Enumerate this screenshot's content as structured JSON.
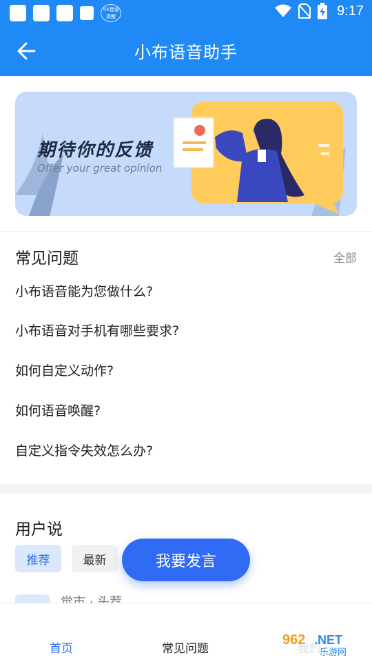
{
  "status": {
    "time": "9:17",
    "badge_top": "55音谱",
    "badge_bottom": "提醒"
  },
  "app_bar": {
    "title": "小布语音助手"
  },
  "banner": {
    "title": "期待你的反馈",
    "subtitle": "Offer your great opinion"
  },
  "faq": {
    "title": "常见问题",
    "all_label": "全部",
    "items": [
      "小布语音能为您做什么?",
      "小布语音对手机有哪些要求?",
      "如何自定义动作?",
      "如何语音唤醒?",
      "自定义指令失效怎么办?"
    ]
  },
  "user_say": {
    "title": "用户说",
    "tabs": [
      "推荐",
      "最新"
    ],
    "speak_button": "我要发言",
    "peek_text": "觉市 · 头荐"
  },
  "bottom_nav": {
    "items": [
      "首页",
      "常见问题",
      "我的"
    ]
  },
  "watermark": {
    "text_top": "962.NET",
    "text_bottom": "乐游网"
  },
  "colors": {
    "primary": "#1f8af5",
    "accent": "#2f6bf5",
    "chip_bg": "#dbe8fc"
  }
}
